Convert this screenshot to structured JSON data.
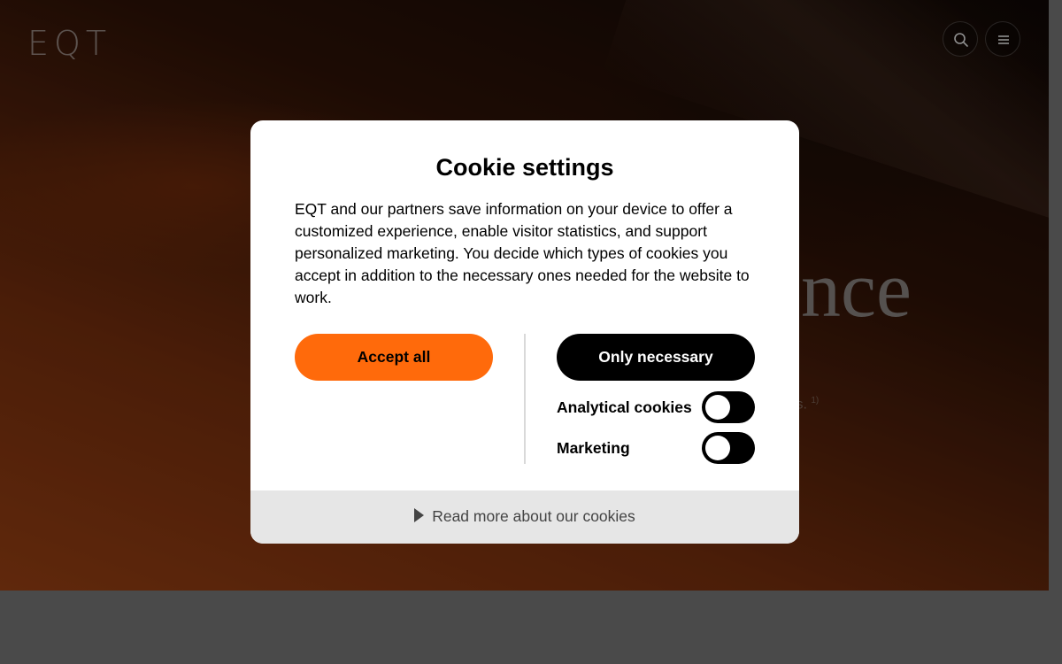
{
  "header": {
    "logo": "EQT",
    "search_icon": "search-icon",
    "menu_icon": "menu-icon"
  },
  "hero": {
    "headline_fragment": "nce",
    "subtext_fragment": "ts.",
    "footnote": "1)"
  },
  "cookie_modal": {
    "title": "Cookie settings",
    "description": "EQT and our partners save information on your device to offer a customized experience, enable visitor statistics, and support personalized marketing. You decide which types of cookies you accept in addition to the necessary ones needed for the website to work.",
    "accept_all_label": "Accept all",
    "only_necessary_label": "Only necessary",
    "toggles": [
      {
        "label": "Analytical cookies",
        "enabled": false
      },
      {
        "label": "Marketing",
        "enabled": false
      }
    ],
    "read_more_label": "Read more about our cookies"
  },
  "colors": {
    "accent": "#ff6a0b",
    "dark_button": "#000000",
    "footer_bg": "#e6e6e6"
  }
}
